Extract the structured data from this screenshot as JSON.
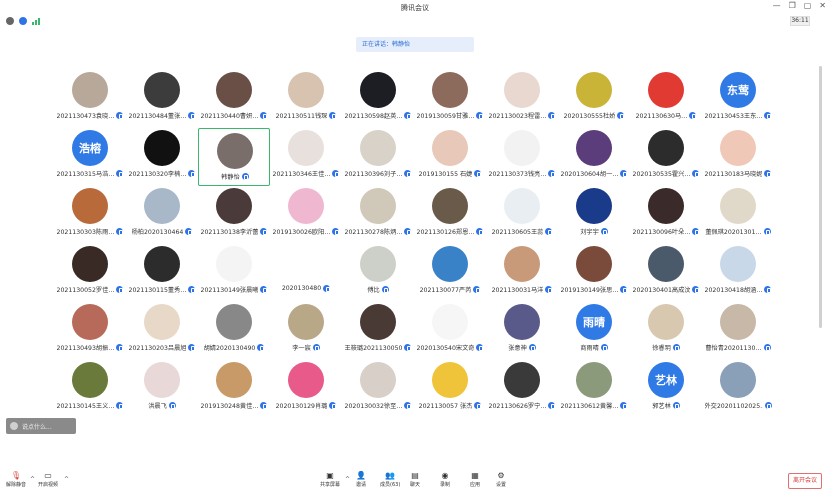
{
  "window": {
    "title": "腾讯会议",
    "timer": "36:11",
    "ctrl_min": "—",
    "ctrl_restore": "❐",
    "ctrl_full": "▢",
    "ctrl_close": "✕"
  },
  "banner": {
    "speaking": "正在讲话：韩静怡"
  },
  "toast": {
    "text": "说点什么..."
  },
  "participants": [
    {
      "name": "2021130473袁晓…",
      "color": "#b8a89a"
    },
    {
      "name": "2021130484董张…",
      "color": "#3c3c3c"
    },
    {
      "name": "2021130440曹妍…",
      "color": "#6a4f46"
    },
    {
      "name": "2021130511钱琛",
      "color": "#d8c2b0"
    },
    {
      "name": "2021130598赵英…",
      "color": "#1d1d24"
    },
    {
      "name": "2019130059甘雅…",
      "color": "#8c6a5c"
    },
    {
      "name": "2021130023程雷…",
      "color": "#e8d8d0"
    },
    {
      "name": "2020130555杜娇",
      "color": "#c9b437"
    },
    {
      "name": "2021130630马…",
      "color": "#e03a32"
    },
    {
      "name": "2021130453王东…",
      "color": "#2f7ae5",
      "text": "东莺"
    },
    {
      "name": "2021130315马浩…",
      "color": "#2f7ae5",
      "text": "浩榕"
    },
    {
      "name": "2021130320李楠…",
      "color": "#111111"
    },
    {
      "name": "韩静怡",
      "color": "#7a6e6a",
      "active": true
    },
    {
      "name": "2021130346王佳…",
      "color": "#e8e0dc"
    },
    {
      "name": "2021130396刘子…",
      "color": "#d9d2c8"
    },
    {
      "name": "2019130155 石婕",
      "color": "#e8c8b8"
    },
    {
      "name": "2021130373钱亮…",
      "color": "#f2f2f2"
    },
    {
      "name": "2020130604胡一…",
      "color": "#5a3d7a"
    },
    {
      "name": "2020130535霍兴…",
      "color": "#2c2c2c"
    },
    {
      "name": "2021130183马晓妮",
      "color": "#f0c8b8"
    },
    {
      "name": "2021130303陈雨…",
      "color": "#b86a3a"
    },
    {
      "name": "杨柏2020130464",
      "color": "#a8b8c8"
    },
    {
      "name": "2021130138李沂蕾",
      "color": "#4a3a3a"
    },
    {
      "name": "2019130026欧阳…",
      "color": "#f0b8d0"
    },
    {
      "name": "2021130278陈炳…",
      "color": "#d0c8b8"
    },
    {
      "name": "2021130126郑恩…",
      "color": "#6a5a4a"
    },
    {
      "name": "2021130605王蕊",
      "color": "#e8eef2"
    },
    {
      "name": "刘宇宇",
      "color": "#1a3a8a"
    },
    {
      "name": "2021130096叶朵…",
      "color": "#3a2a2a"
    },
    {
      "name": "董佩琪20201301…",
      "color": "#e0d8c8"
    },
    {
      "name": "2021130052罗佳…",
      "color": "#3a2a26"
    },
    {
      "name": "2021130115董秀…",
      "color": "#2c2c2c"
    },
    {
      "name": "2021130149张晨曦",
      "color": "#f4f4f4"
    },
    {
      "name": "2020130480",
      "color": "#ffffff"
    },
    {
      "name": "傅比",
      "color": "#ccd0c8"
    },
    {
      "name": "2021130077严芮",
      "color": "#3a82c8"
    },
    {
      "name": "2021130031马洋",
      "color": "#c89a7a"
    },
    {
      "name": "2019130149张思…",
      "color": "#7a4a3a"
    },
    {
      "name": "2020130401高成汶",
      "color": "#4a5a6a"
    },
    {
      "name": "2020130418胡涵…",
      "color": "#c8d8e8"
    },
    {
      "name": "2021130493胡振…",
      "color": "#b86a5a"
    },
    {
      "name": "2021130203吕晨旭",
      "color": "#e8d8c8"
    },
    {
      "name": "胡婧2020130490",
      "color": "#888888"
    },
    {
      "name": "李一宸",
      "color": "#b8a888"
    },
    {
      "name": "王筱璐2021130050",
      "color": "#4a3a36"
    },
    {
      "name": "2020130540宋文奇",
      "color": "#f6f6f6"
    },
    {
      "name": "张意神",
      "color": "#5a5a8a"
    },
    {
      "name": "商雨晴",
      "color": "#2f7ae5",
      "text": "雨晴"
    },
    {
      "name": "徐睿玥",
      "color": "#d8c8b0"
    },
    {
      "name": "曹怡青20201130…",
      "color": "#c8b8a8"
    },
    {
      "name": "2021130145王义…",
      "color": "#6a7a3a"
    },
    {
      "name": "洪晨飞",
      "color": "#e8d8d8"
    },
    {
      "name": "2019130248黄佳…",
      "color": "#c89a68"
    },
    {
      "name": "2020130129肖璐",
      "color": "#e85a8a"
    },
    {
      "name": "2020130032徐至…",
      "color": "#d8d0c8"
    },
    {
      "name": "2021130057 张杰",
      "color": "#f0c43a"
    },
    {
      "name": "2021130626罗宁…",
      "color": "#3a3a3a"
    },
    {
      "name": "2021130612黄馨…",
      "color": "#8a9a7a"
    },
    {
      "name": "郭艺林",
      "color": "#2f7ae5",
      "text": "艺林"
    },
    {
      "name": "外交20201102025…",
      "color": "#8aa0b8"
    }
  ],
  "toolbar": {
    "mute": "解除静音",
    "video": "开启视频",
    "share": "共享屏幕",
    "invite": "邀请",
    "members": "成员(63)",
    "chat": "聊天",
    "record": "录制",
    "apps": "应用",
    "settings": "设置",
    "leave": "离开会议"
  }
}
